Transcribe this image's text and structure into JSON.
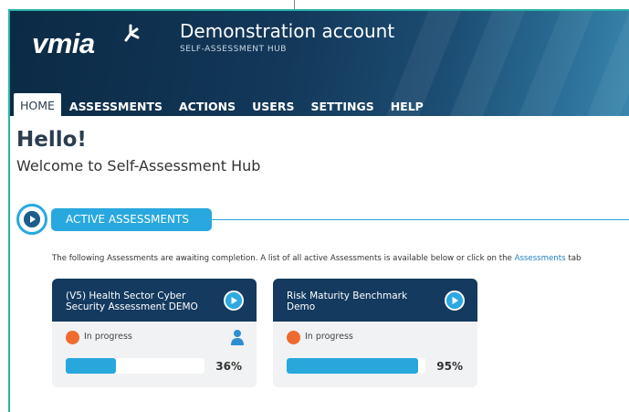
{
  "header": {
    "logo_text": "vmia",
    "account_title": "Demonstration account",
    "account_subtitle": "SELF-ASSESSMENT HUB"
  },
  "nav": {
    "items": [
      {
        "label": "HOME",
        "active": true
      },
      {
        "label": "ASSESSMENTS",
        "active": false
      },
      {
        "label": "ACTIONS",
        "active": false
      },
      {
        "label": "USERS",
        "active": false
      },
      {
        "label": "SETTINGS",
        "active": false
      },
      {
        "label": "HELP",
        "active": false
      }
    ]
  },
  "main": {
    "greeting": "Hello!",
    "welcome": "Welcome to Self-Assessment Hub",
    "section_title": "ACTIVE ASSESSMENTS",
    "intro_text": "The following Assessments are awaiting completion. A list of all active Assessments is available below or click on the ",
    "intro_link": "Assessments",
    "intro_suffix": " tab"
  },
  "cards": [
    {
      "title": "(V5) Health Sector Cyber Security Assessment DEMO",
      "status": "In progress",
      "progress": 0.36,
      "percent_label": "36%",
      "has_user_icon": true
    },
    {
      "title": "Risk Maturity Benchmark Demo",
      "status": "In progress",
      "progress": 0.95,
      "percent_label": "95%",
      "has_user_icon": false
    }
  ],
  "colors": {
    "accent": "#28a8de",
    "header_dark": "#0b2a44",
    "card_head": "#143a5f",
    "status_orange": "#ee6a2e",
    "frame_teal": "#2bb3a8"
  },
  "icons": {
    "logo_mark": "vmia-star-icon",
    "play": "play-icon",
    "user": "user-icon"
  }
}
